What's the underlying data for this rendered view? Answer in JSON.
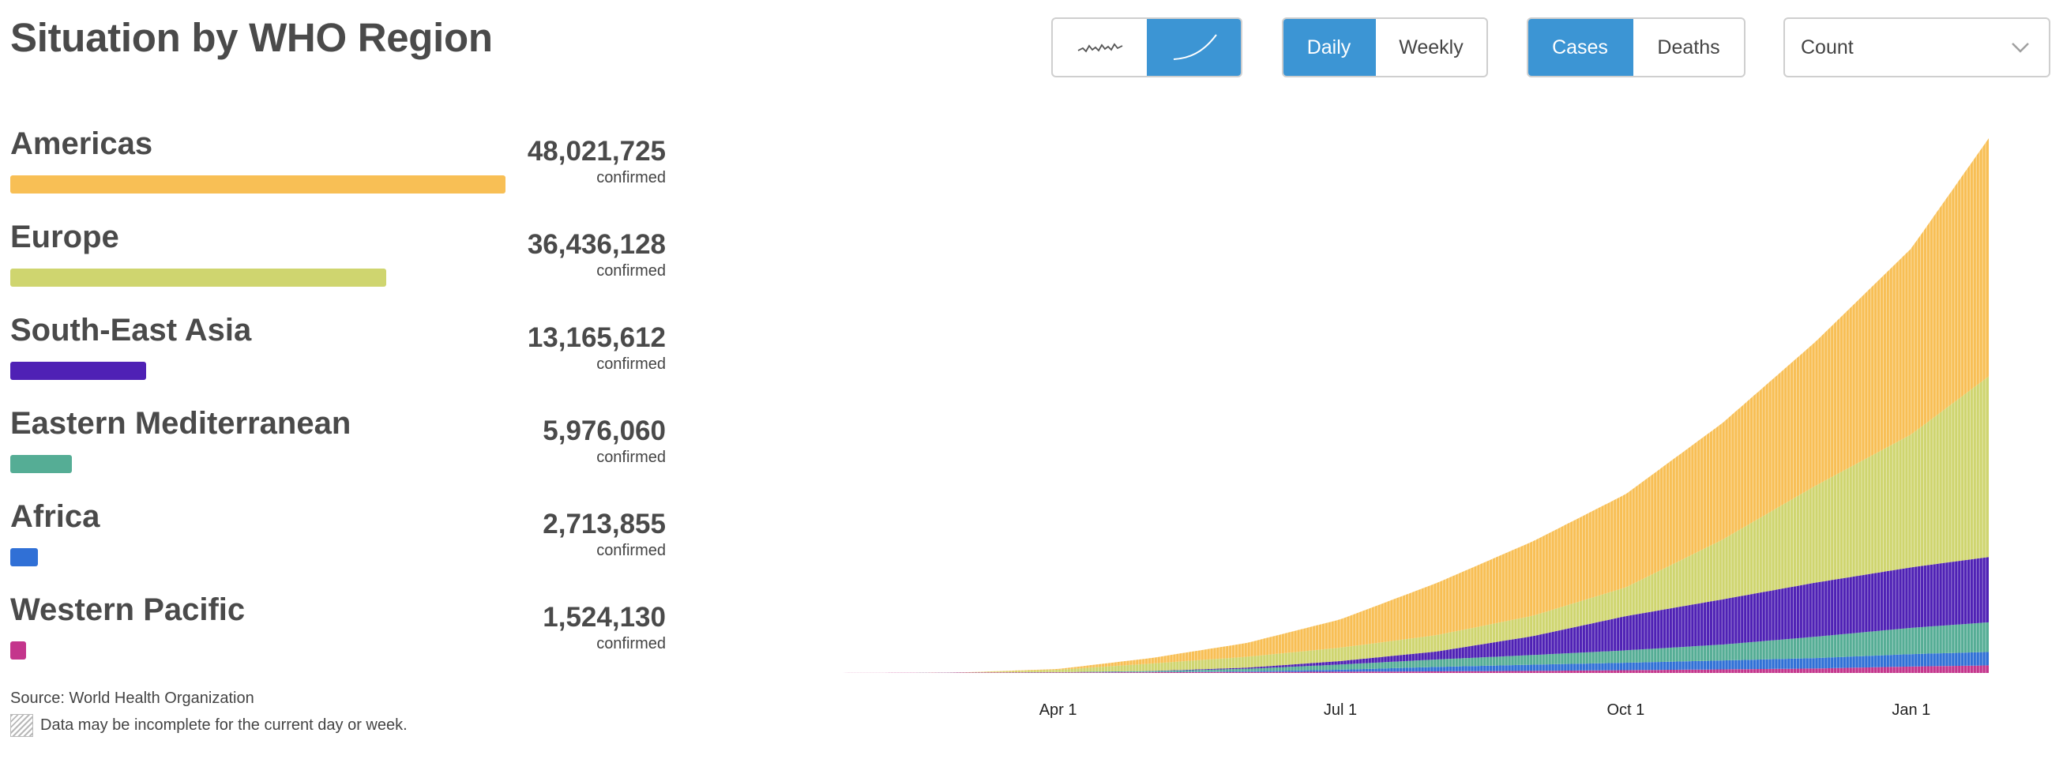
{
  "page": {
    "title": "Situation by WHO Region"
  },
  "controls": {
    "chart_type": {
      "options": [
        "daily-icon",
        "cumulative-icon"
      ],
      "selected": "cumulative-icon"
    },
    "frequency": {
      "options": [
        "Daily",
        "Weekly"
      ],
      "selected": "Daily"
    },
    "metric": {
      "options": [
        "Cases",
        "Deaths"
      ],
      "selected": "Cases"
    },
    "scale": {
      "value": "Count",
      "icon": "chevron-down-icon"
    }
  },
  "regions": [
    {
      "name": "Americas",
      "value": "48,021,725",
      "count": 48021725,
      "unit": "confirmed",
      "color": "#f8bf55"
    },
    {
      "name": "Europe",
      "value": "36,436,128",
      "count": 36436128,
      "unit": "confirmed",
      "color": "#cfd56f"
    },
    {
      "name": "South-East Asia",
      "value": "13,165,612",
      "count": 13165612,
      "unit": "confirmed",
      "color": "#4f21b5"
    },
    {
      "name": "Eastern Mediterranean",
      "value": "5,976,060",
      "count": 5976060,
      "unit": "confirmed",
      "color": "#55ad95"
    },
    {
      "name": "Africa",
      "value": "2,713,855",
      "count": 2713855,
      "unit": "confirmed",
      "color": "#3070d6"
    },
    {
      "name": "Western Pacific",
      "value": "1,524,130",
      "count": 1524130,
      "unit": "confirmed",
      "color": "#c4358c"
    }
  ],
  "footer": {
    "source_label": "Source:",
    "source_name": "World Health Organization",
    "note": "Data may be incomplete for the current day or week.",
    "note_icon": "hatch-pattern-icon"
  },
  "chart_data": {
    "type": "area",
    "stacked": true,
    "cumulative": true,
    "metric": "Cases",
    "frequency": "Daily",
    "x_tick_labels": [
      "Apr 1",
      "Jul 1",
      "Oct 1",
      "Jan 1"
    ],
    "x_tick_dates": [
      "2020-04-01",
      "2020-07-01",
      "2020-10-01",
      "2021-01-01"
    ],
    "x": [
      "2020-01-03",
      "2020-02-01",
      "2020-03-01",
      "2020-04-01",
      "2020-05-01",
      "2020-06-01",
      "2020-07-01",
      "2020-08-01",
      "2020-09-01",
      "2020-10-01",
      "2020-11-01",
      "2020-12-01",
      "2021-01-01",
      "2021-01-26"
    ],
    "series": [
      {
        "name": "Western Pacific",
        "color": "#c4358c",
        "values": [
          0,
          11000,
          80000,
          110000,
          150000,
          200000,
          250000,
          320000,
          420000,
          560000,
          720000,
          900000,
          1300000,
          1524130
        ]
      },
      {
        "name": "Africa",
        "color": "#3070d6",
        "values": [
          0,
          0,
          3000,
          6000,
          40000,
          140000,
          400000,
          900000,
          1250000,
          1500000,
          1800000,
          2100000,
          2500000,
          2713855
        ]
      },
      {
        "name": "Eastern Mediterranean",
        "color": "#55ad95",
        "values": [
          0,
          0,
          12000,
          60000,
          170000,
          500000,
          1050000,
          1500000,
          1950000,
          2500000,
          3200000,
          4300000,
          5300000,
          5976060
        ]
      },
      {
        "name": "South-East Asia",
        "color": "#4f21b5",
        "values": [
          0,
          0,
          1000,
          3000,
          40000,
          230000,
          700000,
          1600000,
          3800000,
          6900000,
          9100000,
          10900000,
          12200000,
          13165612
        ]
      },
      {
        "name": "Europe",
        "color": "#cfd56f",
        "values": [
          0,
          0,
          6000,
          450000,
          1500000,
          2200000,
          2700000,
          3300000,
          4100000,
          5800000,
          12000000,
          19500000,
          26800000,
          36436128
        ]
      },
      {
        "name": "Americas",
        "color": "#f8bf55",
        "values": [
          0,
          0,
          200,
          170000,
          1100000,
          2800000,
          5700000,
          10500000,
          15000000,
          18800000,
          23500000,
          29000000,
          37500000,
          48021725
        ]
      }
    ]
  }
}
